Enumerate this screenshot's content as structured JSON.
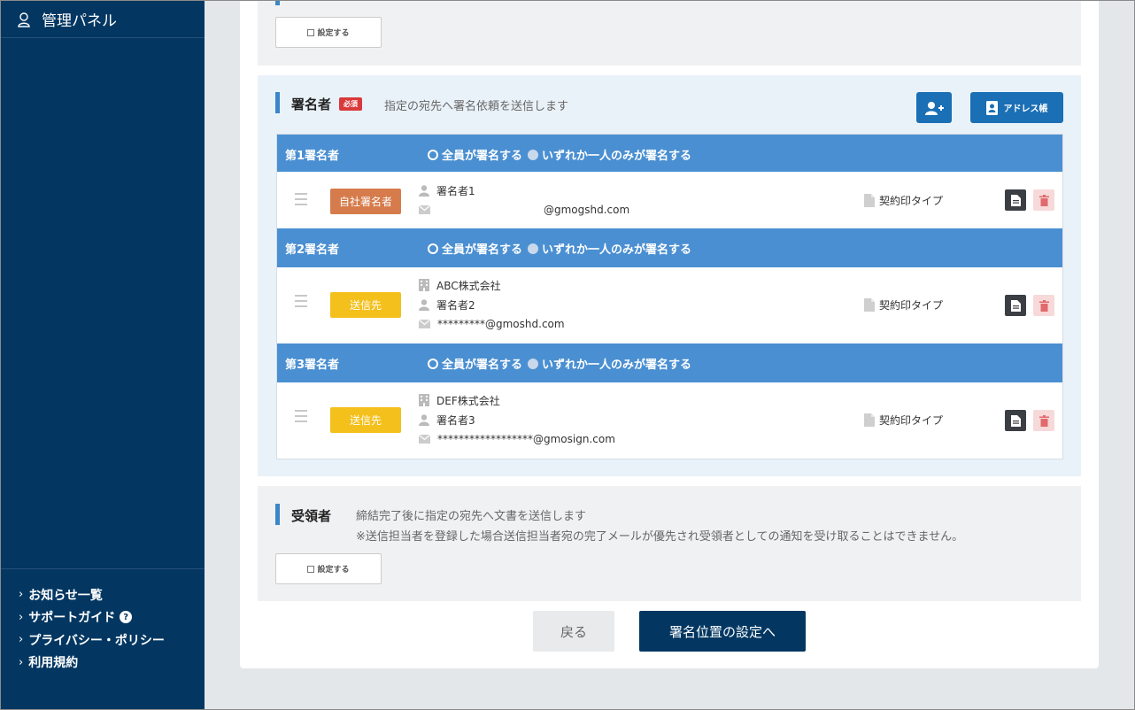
{
  "sidebar": {
    "title": "管理パネル",
    "links": [
      {
        "label": "お知らせ一覧",
        "help": false
      },
      {
        "label": "サポートガイド",
        "help": true
      },
      {
        "label": "プライバシー・ポリシー",
        "help": false
      },
      {
        "label": "利用規約",
        "help": false
      }
    ]
  },
  "top_section": {
    "set_label": "設定する"
  },
  "signers_section": {
    "title": "署名者",
    "required_badge": "必須",
    "description": "指定の宛先へ署名依頼を送信します",
    "add_button_icon": "user-plus-icon",
    "address_book_label": "アドレス帳",
    "option_all": "全員が署名する",
    "option_any": "いずれか一人のみが署名する",
    "groups": [
      {
        "title": "第1署名者",
        "tag": "自社署名者",
        "company": "",
        "name": "署名者1",
        "email": "@gmogshd.com",
        "seal": "契約印タイプ"
      },
      {
        "title": "第2署名者",
        "tag": "送信先",
        "company": "ABC株式会社",
        "name": "署名者2",
        "email": "*********@gmoshd.com",
        "seal": "契約印タイプ"
      },
      {
        "title": "第3署名者",
        "tag": "送信先",
        "company": "DEF株式会社",
        "name": "署名者3",
        "email": "******************@gmosign.com",
        "seal": "契約印タイプ"
      }
    ]
  },
  "recipients_section": {
    "title": "受領者",
    "description": "締結完了後に指定の宛先へ文書を送信します",
    "note": "※送信担当者を登録した場合送信担当者宛の完了メールが優先され受領者としての通知を受け取ることはできません。",
    "set_label": "設定する"
  },
  "footer": {
    "back_label": "戻る",
    "next_label": "署名位置の設定へ"
  },
  "colors": {
    "sidebar": "#033762",
    "accent": "#4a8fd1",
    "self_tag": "#d67b4b",
    "dest_tag": "#f4c01b",
    "required": "#d9393b"
  }
}
